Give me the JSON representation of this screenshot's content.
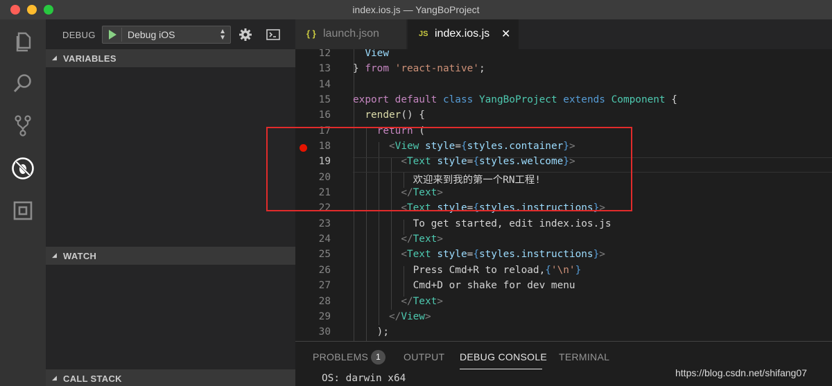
{
  "window": {
    "title": "index.ios.js — YangBoProject"
  },
  "activity_bar": {
    "items": [
      {
        "icon": "files-icon"
      },
      {
        "icon": "search-icon"
      },
      {
        "icon": "source-control-icon"
      },
      {
        "icon": "debug-icon"
      },
      {
        "icon": "extensions-icon"
      }
    ]
  },
  "debug": {
    "label": "DEBUG",
    "config": "Debug iOS"
  },
  "sidebar": {
    "variables": "VARIABLES",
    "watch": "WATCH",
    "call_stack": "CALL STACK"
  },
  "tabs": {
    "launch": {
      "icon": "{ }",
      "label": "launch.json"
    },
    "index": {
      "icon": "JS",
      "label": "index.ios.js",
      "close": "✕"
    }
  },
  "editor": {
    "lines": [
      "12",
      "13",
      "14",
      "15",
      "16",
      "17",
      "18",
      "19",
      "20",
      "21",
      "22",
      "23",
      "24",
      "25",
      "26",
      "27",
      "28",
      "29",
      "30"
    ],
    "active_line": "19",
    "breakpoint_line": "18",
    "chinese_text": "欢迎来到我的第一个RN工程!",
    "line23_text": "To get started, edit index.ios.js",
    "line26_text": "Press Cmd+R to reload,",
    "line26_str": "'\\n'",
    "line27_text": "Cmd+D or shake for dev menu"
  },
  "panel": {
    "problems": "PROBLEMS",
    "problems_count": "1",
    "output": "OUTPUT",
    "debug_console": "DEBUG CONSOLE",
    "terminal": "TERMINAL",
    "console_output": "OS: darwin x64"
  },
  "watermark": "https://blog.csdn.net/shifang07",
  "colors": {
    "accent_red": "#e22b2b",
    "breakpoint": "#e51400",
    "play_green": "#89d185"
  }
}
